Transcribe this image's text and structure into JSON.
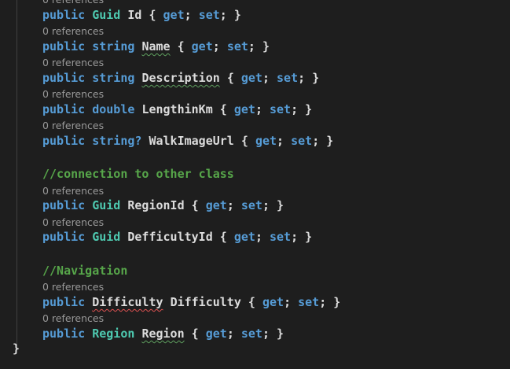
{
  "codelens": {
    "references": "0 references"
  },
  "keywords": {
    "public": "public",
    "string": "string",
    "double": "double",
    "get": "get",
    "set": "set"
  },
  "types": {
    "guid": "Guid",
    "region": "Region",
    "difficulty": "Difficulty"
  },
  "properties": {
    "id": "Id",
    "name": "Name",
    "description": "Description",
    "length": "LengthinKm",
    "walk_image_url": "WalkImageUrl",
    "region_id": "RegionId",
    "difficulty_id": "DefficultyId",
    "difficulty": "Difficulty",
    "region": "Region"
  },
  "syntax": {
    "nullable_string": "string?",
    "open_brace": "{",
    "close_brace": "}",
    "semicolon": ";"
  },
  "comments": {
    "connection": "//connection to other class",
    "navigation": "//Navigation"
  },
  "class_closing_brace": "}"
}
